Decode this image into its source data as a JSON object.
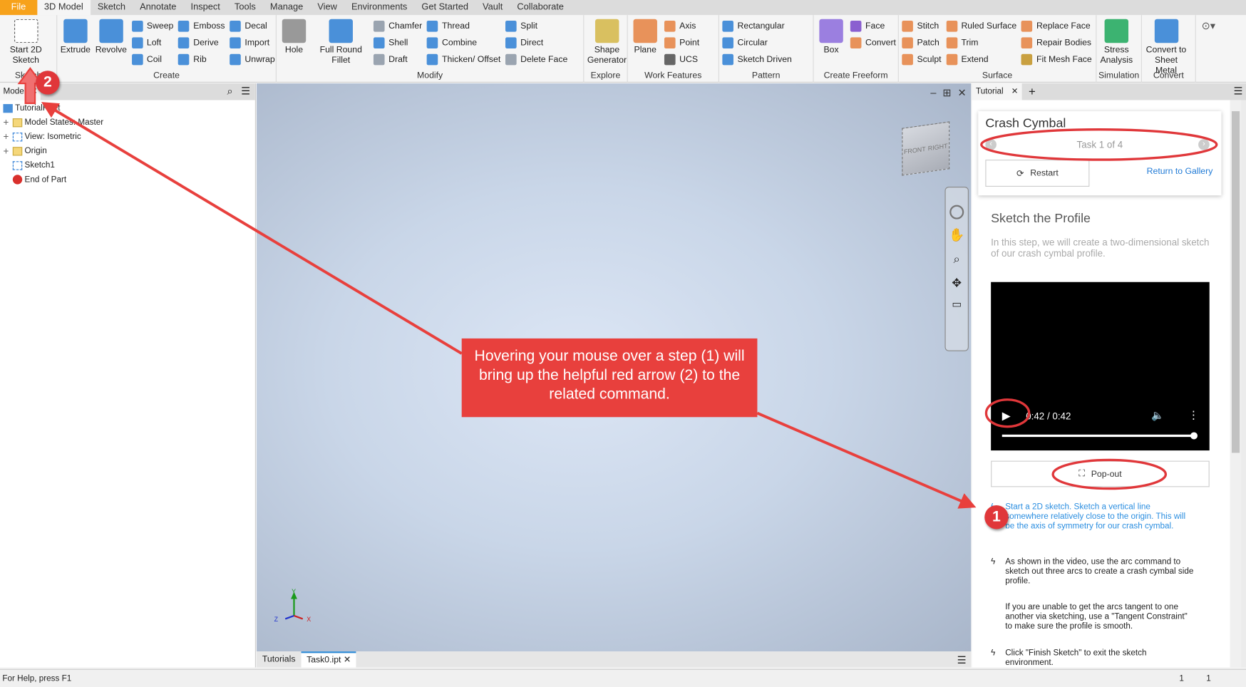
{
  "menu_tabs": [
    "File",
    "3D Model",
    "Sketch",
    "Annotate",
    "Inspect",
    "Tools",
    "Manage",
    "View",
    "Environments",
    "Get Started",
    "Vault",
    "Collaborate"
  ],
  "active_tab": "3D Model",
  "ribbon": [
    {
      "label": "Sketch",
      "cols": [
        {
          "large": "Start 2D Sketch",
          "color": "#ffffff"
        }
      ]
    },
    {
      "label": "Create",
      "cols": [
        {
          "large": "Extrude",
          "color": "#4a90d9"
        },
        {
          "large": "Revolve",
          "color": "#4a90d9"
        },
        {
          "items": [
            [
              "Sweep",
              "#4a90d9"
            ],
            [
              "Loft",
              "#4a90d9"
            ],
            [
              "Coil",
              "#4a90d9"
            ]
          ]
        },
        {
          "items": [
            [
              "Emboss",
              "#4a90d9"
            ],
            [
              "Derive",
              "#4a90d9"
            ],
            [
              "Rib",
              "#4a90d9"
            ]
          ]
        },
        {
          "items": [
            [
              "Decal",
              "#4a90d9"
            ],
            [
              "Import",
              "#4a90d9"
            ],
            [
              "Unwrap",
              "#4a90d9"
            ]
          ]
        }
      ]
    },
    {
      "label": "Modify",
      "cols": [
        {
          "large": "Hole",
          "color": "#999999"
        },
        {
          "large": "Full Round Fillet",
          "color": "#4a90d9"
        },
        {
          "items": [
            [
              "Chamfer",
              "#9aa4b0"
            ],
            [
              "Shell",
              "#4a90d9"
            ],
            [
              "Draft",
              "#9aa4b0"
            ]
          ]
        },
        {
          "items": [
            [
              "Thread",
              "#4a90d9"
            ],
            [
              "Combine",
              "#4a90d9"
            ],
            [
              "Thicken/ Offset",
              "#4a90d9"
            ]
          ]
        },
        {
          "items": [
            [
              "Split",
              "#4a90d9"
            ],
            [
              "Direct",
              "#4a90d9"
            ],
            [
              "Delete Face",
              "#9aa4b0"
            ]
          ]
        }
      ]
    },
    {
      "label": "Explore",
      "cols": [
        {
          "large": "Shape Generator",
          "color": "#d9c060"
        }
      ]
    },
    {
      "label": "Work Features",
      "cols": [
        {
          "large": "Plane",
          "color": "#e8925a"
        },
        {
          "items": [
            [
              "Axis",
              "#e8925a"
            ],
            [
              "Point",
              "#e8925a"
            ],
            [
              "UCS",
              "#666666"
            ]
          ]
        }
      ]
    },
    {
      "label": "Pattern",
      "cols": [
        {
          "items": [
            [
              "Rectangular",
              "#4a90d9"
            ],
            [
              "Circular",
              "#4a90d9"
            ],
            [
              "Sketch Driven",
              "#4a90d9"
            ]
          ]
        }
      ]
    },
    {
      "label": "Create Freeform",
      "cols": [
        {
          "large": "Box",
          "color": "#9b7fe0"
        },
        {
          "items": [
            [
              "Face",
              "#8a5fd0"
            ],
            [
              "Convert",
              "#e8925a"
            ]
          ]
        }
      ]
    },
    {
      "label": "Surface",
      "cols": [
        {
          "items": [
            [
              "Stitch",
              "#e8925a"
            ],
            [
              "Patch",
              "#e8925a"
            ],
            [
              "Sculpt",
              "#e8925a"
            ]
          ]
        },
        {
          "items": [
            [
              "Ruled Surface",
              "#e8925a"
            ],
            [
              "Trim",
              "#e8925a"
            ],
            [
              "Extend",
              "#e8925a"
            ]
          ]
        },
        {
          "items": [
            [
              "Replace Face",
              "#e8925a"
            ],
            [
              "Repair Bodies",
              "#e8925a"
            ],
            [
              "Fit Mesh Face",
              "#c9a040"
            ]
          ]
        }
      ]
    },
    {
      "label": "Simulation",
      "cols": [
        {
          "large": "Stress Analysis",
          "color": "#3cb371"
        }
      ]
    },
    {
      "label": "Convert",
      "cols": [
        {
          "large": "Convert to Sheet Metal",
          "color": "#4a90d9"
        }
      ]
    }
  ],
  "browser": {
    "tab": "Model",
    "items": [
      "TutorialFillet",
      "Model States: Master",
      "View: Isometric",
      "Origin",
      "Sketch1",
      "End of Part"
    ]
  },
  "viewcube": {
    "front": "FRONT",
    "right": "RIGHT"
  },
  "triad": {
    "x": "X",
    "y": "Y",
    "z": "Z"
  },
  "doc_tabs": [
    "Tutorials",
    "Task0.ipt"
  ],
  "tutorial": {
    "tab": "Tutorial",
    "title": "Crash Cymbal",
    "task": "Task 1 of 4",
    "restart": "Restart",
    "return": "Return to Gallery",
    "step_title": "Sketch the Profile",
    "step_desc": "In this step, we will create a two-dimensional sketch of our crash cymbal profile.",
    "video_time": "0:42 / 0:42",
    "video_progress": 1.0,
    "popout": "Pop-out",
    "steps": [
      "Start a 2D sketch. Sketch a vertical line somewhere relatively close to the origin. This will be the axis of symmetry for our crash cymbal.",
      "As shown in the video, use the arc command to sketch out three arcs to create a crash cymbal side profile.",
      "If you are unable to get the arcs tangent to one another via sketching, use a \"Tangent Constraint\" to make sure the profile is smooth.",
      "Click \"Finish Sketch\" to exit the sketch environment."
    ]
  },
  "status": {
    "help": "For Help, press F1",
    "count1": "1",
    "count2": "1"
  },
  "annotation": {
    "callout": "Hovering your mouse over a step (1) will bring up the helpful red arrow (2) to the related command.",
    "badge1": "1",
    "badge2": "2",
    "color": "#e8403d"
  }
}
